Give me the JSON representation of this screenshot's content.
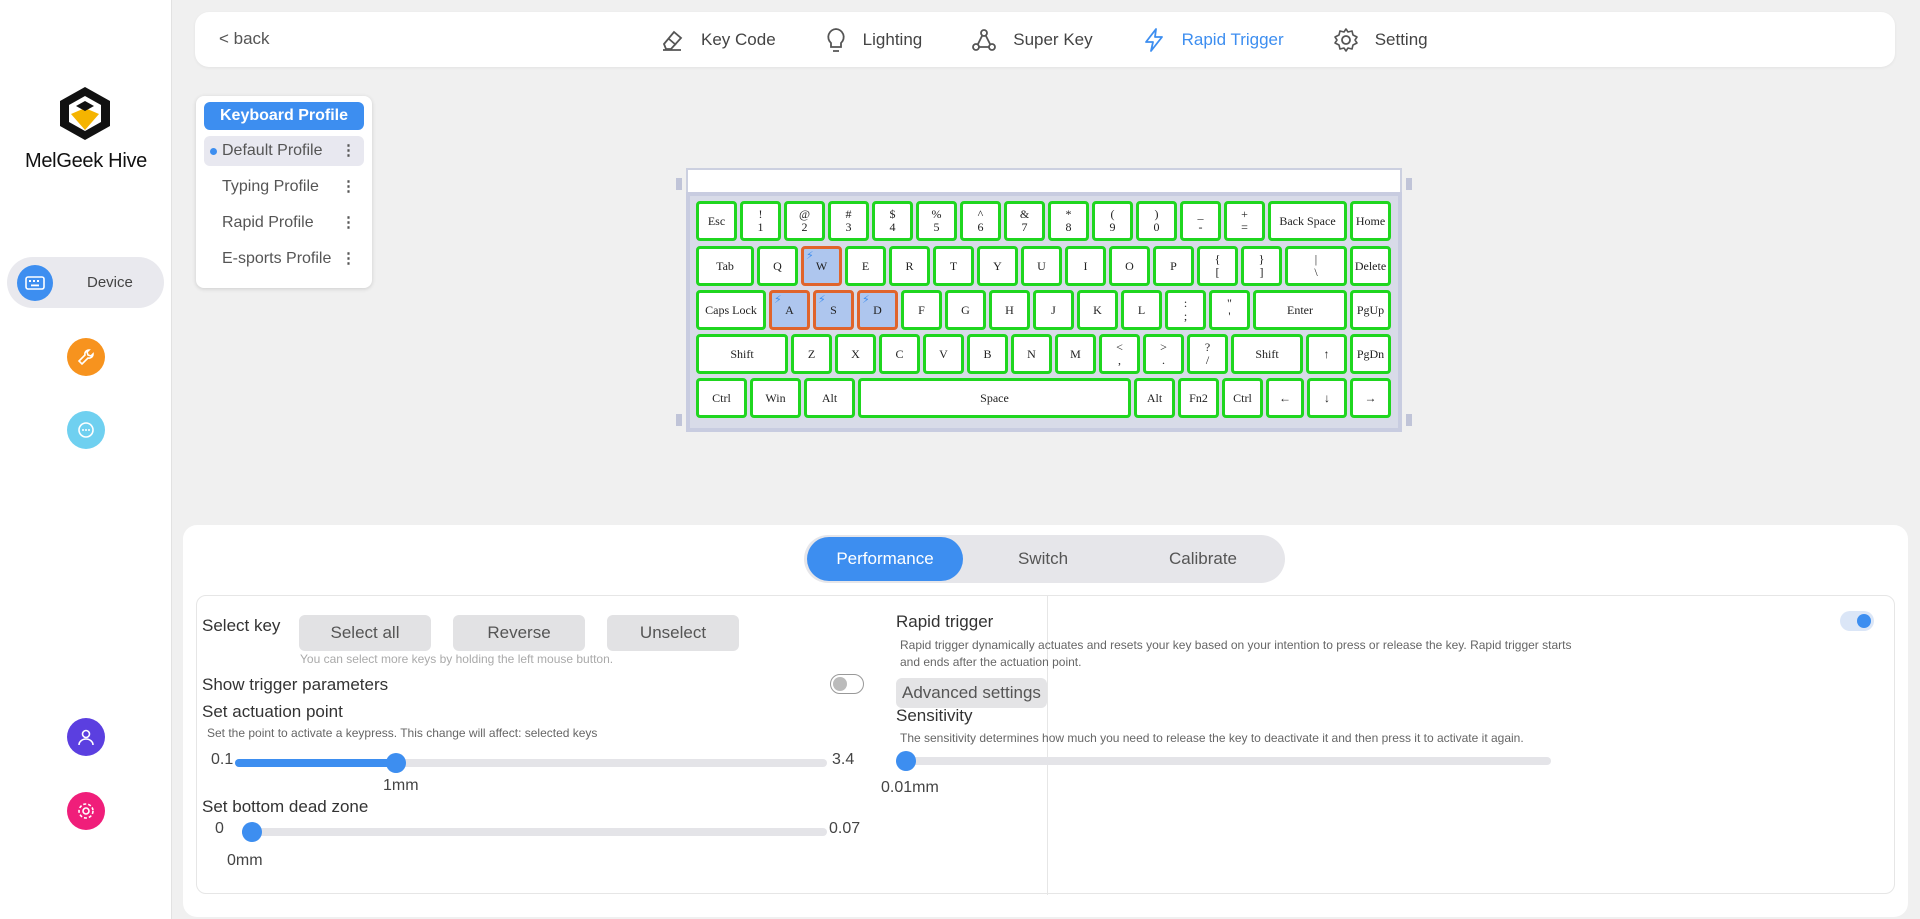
{
  "app": {
    "brand": "MelGeek Hive"
  },
  "sidebar": {
    "device_label": "Device"
  },
  "topnav": {
    "back": "< back",
    "tabs": [
      {
        "label": "Key Code"
      },
      {
        "label": "Lighting"
      },
      {
        "label": "Super Key"
      },
      {
        "label": "Rapid Trigger"
      },
      {
        "label": "Setting"
      }
    ],
    "active_tab": "Rapid Trigger"
  },
  "profiles": {
    "header": "Keyboard Profile",
    "items": [
      {
        "label": "Default Profile"
      },
      {
        "label": "Typing Profile"
      },
      {
        "label": "Rapid Profile"
      },
      {
        "label": "E-sports Profile"
      }
    ],
    "active": "Default Profile"
  },
  "keyboard": {
    "selected_keys": [
      "W",
      "A",
      "S",
      "D"
    ]
  },
  "panel": {
    "tabs": [
      "Performance",
      "Switch",
      "Calibrate"
    ],
    "active_tab": "Performance",
    "select_key_label": "Select key",
    "buttons": {
      "select_all": "Select all",
      "reverse": "Reverse",
      "unselect": "Unselect"
    },
    "select_hint": "You can select more keys by holding the left mouse button.",
    "show_trigger_label": "Show trigger parameters",
    "show_trigger_on": false,
    "actuation": {
      "title": "Set actuation point",
      "desc": "Set the point to activate a keypress. This change will affect: selected keys",
      "min": "0.1",
      "max": "3.4",
      "value_label": "1mm",
      "value": 1
    },
    "dead_zone": {
      "title": "Set bottom dead zone",
      "min": "0",
      "max": "0.07",
      "value_label": "0mm",
      "value": 0
    },
    "rapid": {
      "title": "Rapid trigger",
      "enabled": true,
      "desc": "Rapid trigger dynamically actuates and resets your key based on your intention to press or release the key. Rapid trigger starts and ends after the actuation point.",
      "advanced": "Advanced settings",
      "sensitivity_title": "Sensitivity",
      "sensitivity_desc": "The sensitivity determines how much you need to release the key to deactivate it and then press it to activate it again.",
      "sensitivity_label": "0.01mm",
      "sensitivity_value": 0.01
    }
  },
  "colors": {
    "accent": "#3d8ef0",
    "key_border": "#1fd61f",
    "selected_border": "#e0642b"
  }
}
